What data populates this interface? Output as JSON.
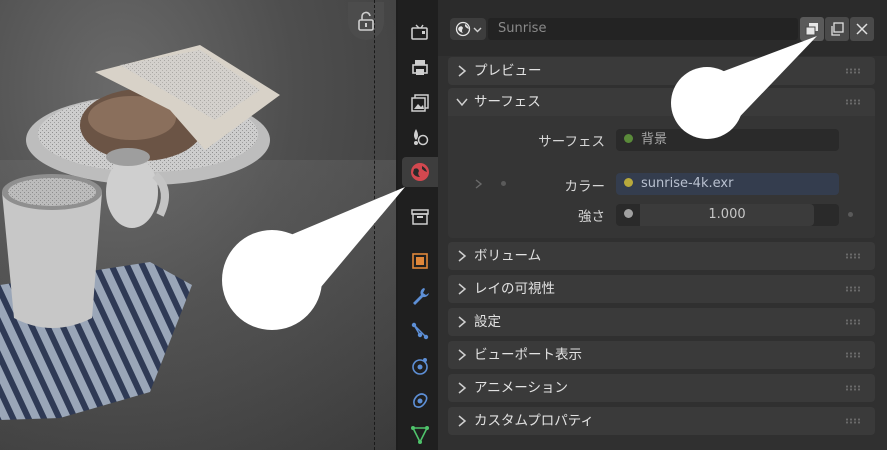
{
  "header": {
    "world_name": "Sunrise"
  },
  "sections": {
    "preview": "プレビュー",
    "surface": "サーフェス",
    "volume": "ボリューム",
    "ray_visibility": "レイの可視性",
    "settings": "設定",
    "viewport_display": "ビューポート表示",
    "animation": "アニメーション",
    "custom_props": "カスタムプロパティ"
  },
  "surface": {
    "surface_label": "サーフェス",
    "surface_value": "背景",
    "color_label": "カラー",
    "color_value": "sunrise-4k.exr",
    "strength_label": "強さ",
    "strength_value": "1.000"
  },
  "colors": {
    "accent_node_green": "#5a8a3a",
    "color_socket_yellow": "#b8a93c",
    "float_socket_gray": "#a1a1a1",
    "active_tab_world": "#d2484f"
  },
  "icons": {
    "tabs": [
      "render-icon",
      "output-icon",
      "view-layer-icon",
      "scene-icon",
      "world-icon",
      "collection-icon",
      "object-icon",
      "modifier-icon",
      "particles-icon",
      "physics-icon",
      "constraints-icon",
      "data-icon"
    ]
  }
}
